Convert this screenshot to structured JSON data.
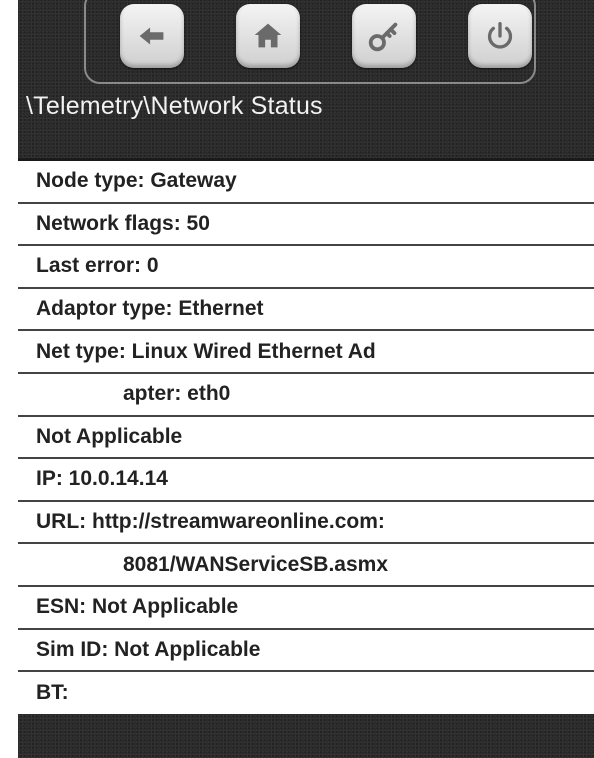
{
  "toolbar": {
    "buttons": [
      {
        "name": "back",
        "icon": "arrow-left-icon"
      },
      {
        "name": "home",
        "icon": "home-icon"
      },
      {
        "name": "key",
        "icon": "key-icon"
      },
      {
        "name": "power",
        "icon": "power-icon"
      }
    ]
  },
  "breadcrumb": "\\Telemetry\\Network Status",
  "rows": [
    {
      "text": "Node type: Gateway",
      "indent": false
    },
    {
      "text": "Network flags: 50",
      "indent": false
    },
    {
      "text": "Last error: 0",
      "indent": false
    },
    {
      "text": "Adaptor type: Ethernet",
      "indent": false
    },
    {
      "text": "Net type: Linux Wired Ethernet Ad",
      "indent": false
    },
    {
      "text": "apter: eth0",
      "indent": true
    },
    {
      "text": "Not Applicable",
      "indent": false
    },
    {
      "text": "IP: 10.0.14.14",
      "indent": false
    },
    {
      "text": "URL: http://streamwareonline.com:",
      "indent": false
    },
    {
      "text": "8081/WANServiceSB.asmx",
      "indent": true
    },
    {
      "text": "ESN: Not Applicable",
      "indent": false
    },
    {
      "text": "Sim ID: Not Applicable",
      "indent": false
    },
    {
      "text": "BT:",
      "indent": false
    }
  ],
  "colors": {
    "background": "#2a2a2a",
    "list_background": "#ffffff",
    "text": "#222222",
    "breadcrumb_text": "#f2f2f2",
    "toolbar_border": "#8a8a8a"
  }
}
